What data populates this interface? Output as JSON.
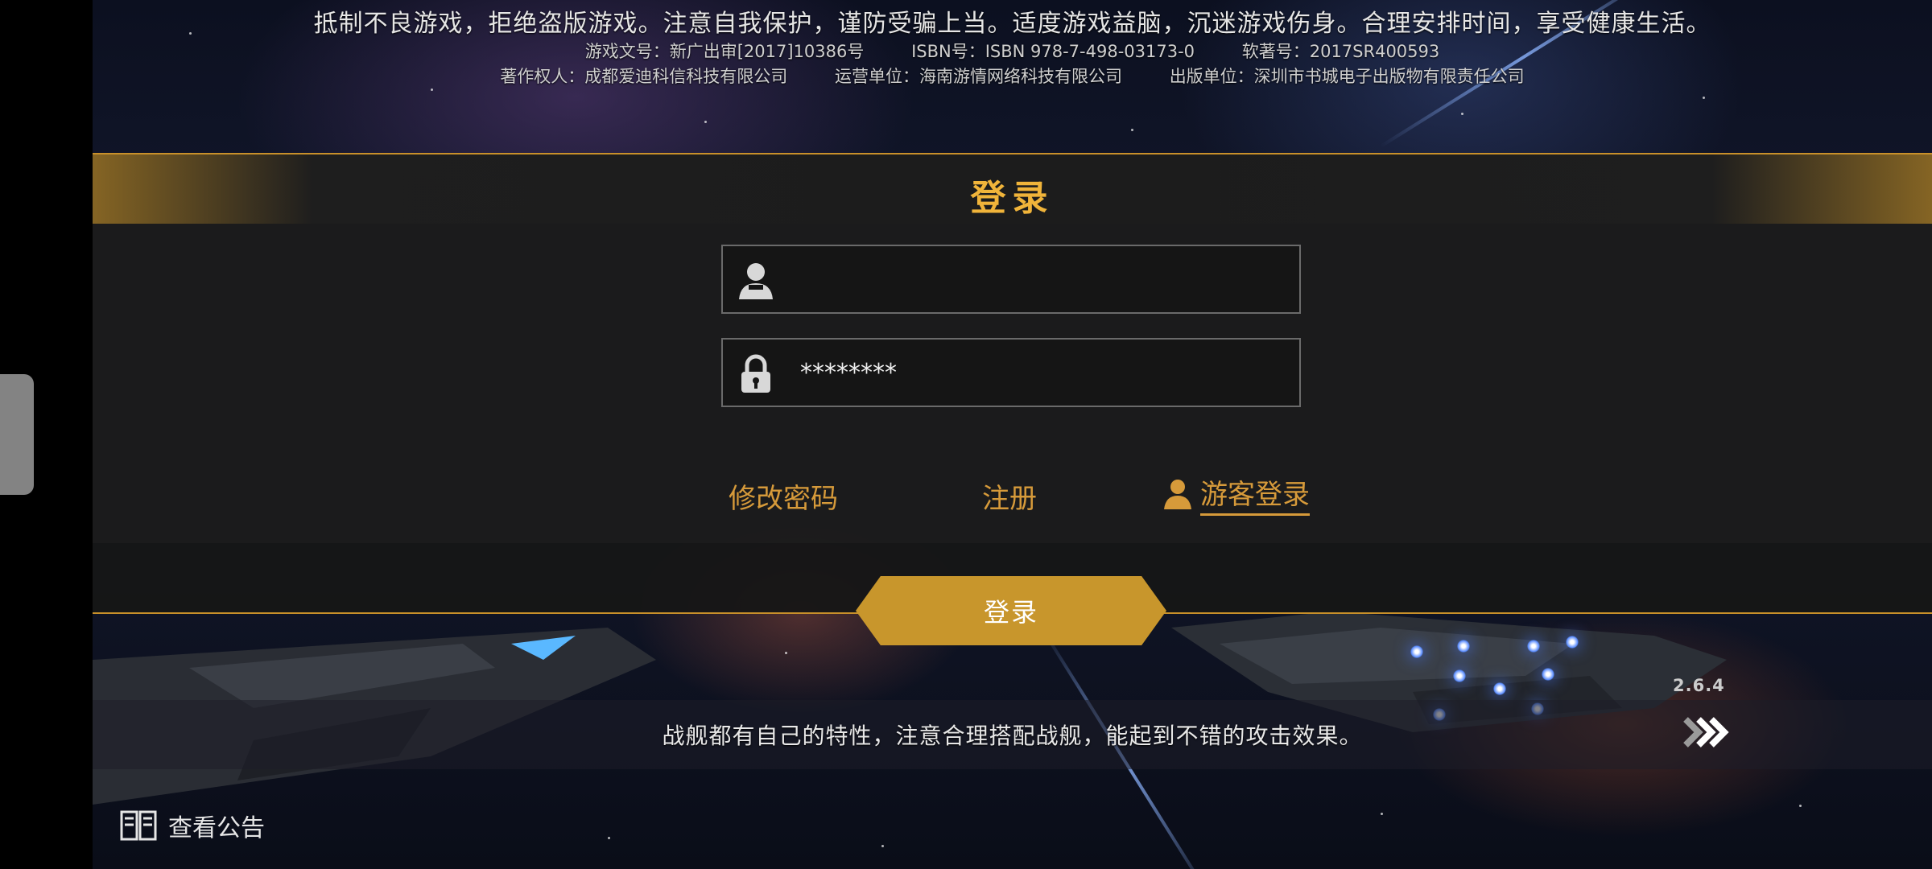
{
  "header": {
    "notice_main": "抵制不良游戏，拒绝盗版游戏。注意自我保护，谨防受骗上当。适度游戏益脑，沉迷游戏伤身。合理安排时间，享受健康生活。",
    "approval_no": "游戏文号：新广出审[2017]10386号",
    "isbn": "ISBN号：ISBN 978-7-498-03173-0",
    "software_no": "软著号：2017SR400593",
    "copyright_owner": "著作权人：成都爱迪科信科技有限公司",
    "operator": "运营单位：海南游情网络科技有限公司",
    "publisher": "出版单位：深圳市书城电子出版物有限责任公司"
  },
  "login_panel": {
    "title": "登录",
    "username": {
      "value": "",
      "placeholder": "",
      "icon": "user-icon"
    },
    "password": {
      "value": "********",
      "icon": "lock-icon"
    },
    "change_password_label": "修改密码",
    "register_label": "注册",
    "guest_login_label": "游客登录",
    "login_button_label": "登录"
  },
  "footer": {
    "tip_text": "战舰都有自己的特性，注意合理搭配战舰，能起到不错的攻击效果。",
    "next_icon": "double-chevron-right-icon",
    "version": "2.6.4",
    "notice_label": "查看公告",
    "notice_icon": "book-icon"
  },
  "colors": {
    "accent_gold": "#c8962c",
    "link_gold": "#d69a3a",
    "title_gold": "#f0b43a",
    "panel_bg": "#1c1c1c"
  }
}
